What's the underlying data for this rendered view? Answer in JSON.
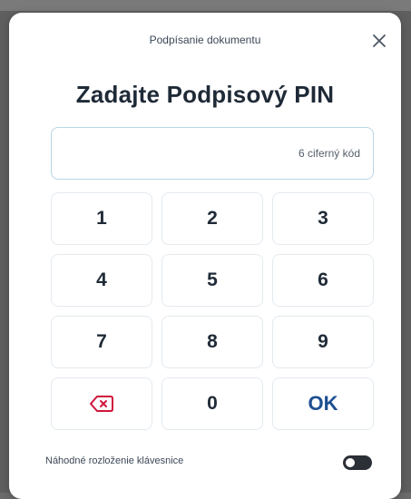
{
  "modal": {
    "subtitle": "Podpísanie dokumentu",
    "title": "Zadajte Podpisový PIN"
  },
  "pin": {
    "placeholder": "6 ciferný kód",
    "value": ""
  },
  "keypad": {
    "keys": [
      "1",
      "2",
      "3",
      "4",
      "5",
      "6",
      "7",
      "8",
      "9",
      "backspace",
      "0",
      "OK"
    ],
    "ok_label": "OK",
    "accent_color": "#1d4f91",
    "backspace_icon_color": "#d0163b"
  },
  "footer": {
    "random_layout_label": "Náhodné rozloženie klávesnice",
    "random_layout_enabled": false
  },
  "icons": {
    "close": "close-icon",
    "backspace": "backspace-icon"
  }
}
